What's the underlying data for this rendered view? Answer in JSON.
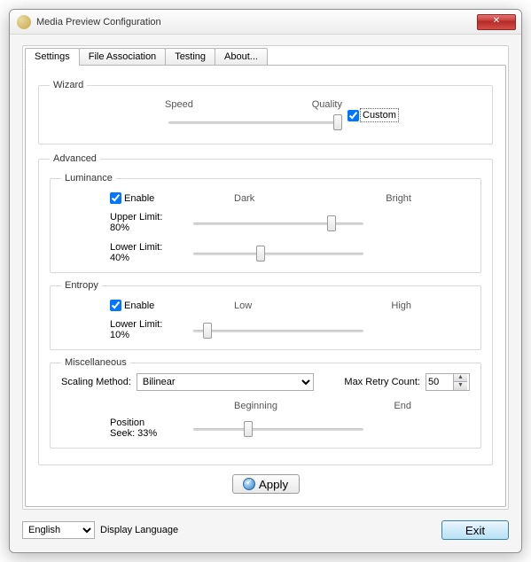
{
  "window": {
    "title": "Media Preview Configuration"
  },
  "tabs": [
    {
      "label": "Settings"
    },
    {
      "label": "File Association"
    },
    {
      "label": "Testing"
    },
    {
      "label": "About..."
    }
  ],
  "wizard": {
    "legend": "Wizard",
    "speed_label": "Speed",
    "quality_label": "Quality",
    "custom_label": "Custom",
    "custom_checked": true,
    "slider_value": 100
  },
  "advanced": {
    "legend": "Advanced",
    "luminance": {
      "legend": "Luminance",
      "enable_label": "Enable",
      "enable_checked": true,
      "dark_label": "Dark",
      "bright_label": "Bright",
      "upper_limit_label": "Upper Limit: 80%",
      "upper_limit_value": 80,
      "lower_limit_label": "Lower Limit: 40%",
      "lower_limit_value": 40
    },
    "entropy": {
      "legend": "Entropy",
      "enable_label": "Enable",
      "enable_checked": true,
      "low_label": "Low",
      "high_label": "High",
      "lower_limit_label": "Lower Limit: 10%",
      "lower_limit_value": 10
    },
    "misc": {
      "legend": "Miscellaneous",
      "scaling_label": "Scaling Method:",
      "scaling_value": "Bilinear",
      "max_retry_label": "Max Retry Count:",
      "max_retry_value": "50",
      "beginning_label": "Beginning",
      "end_label": "End",
      "position_label": "Position Seek: 33%",
      "position_value": 33
    }
  },
  "buttons": {
    "apply": "Apply",
    "exit": "Exit"
  },
  "footer": {
    "language_value": "English",
    "language_label": "Display Language"
  }
}
